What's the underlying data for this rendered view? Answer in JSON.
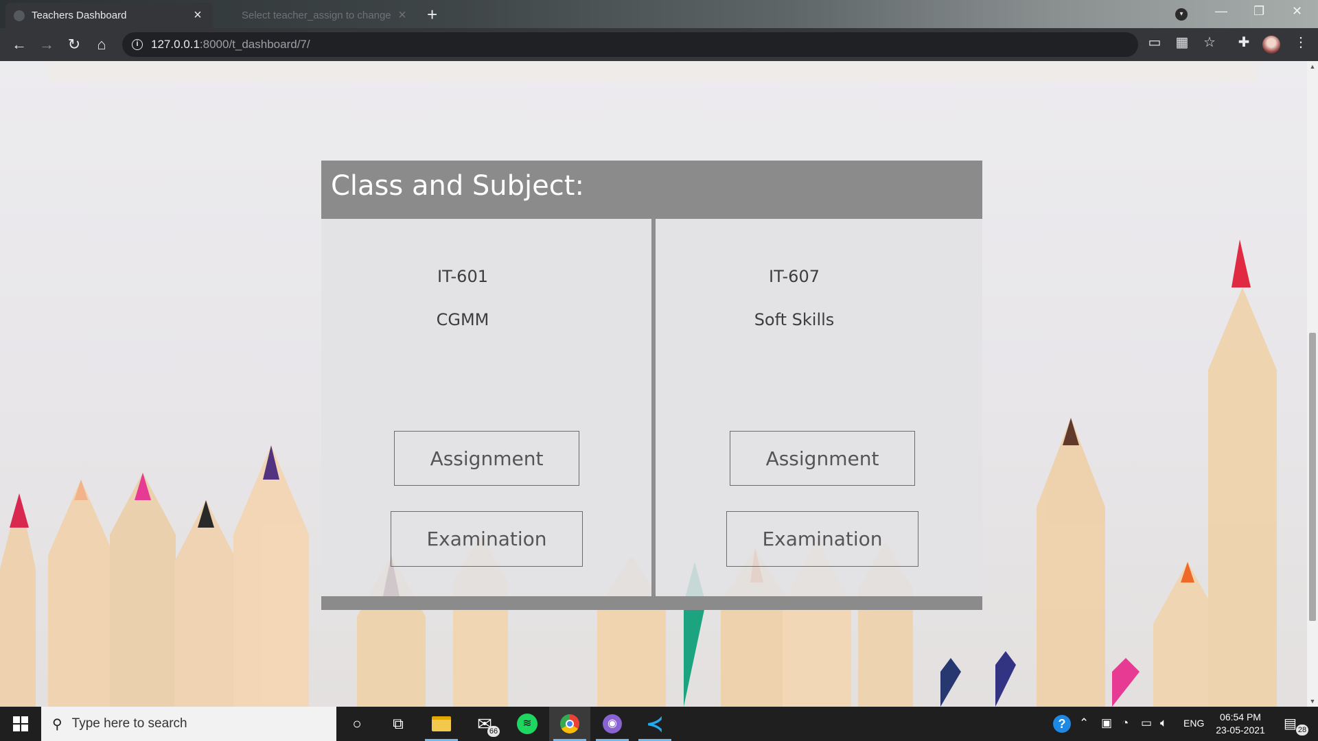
{
  "browser": {
    "tabs": [
      {
        "title": "Teachers Dashboard",
        "active": true
      },
      {
        "title": "Select teacher_assign to change",
        "active": false
      }
    ],
    "url_host": "127.0.0.1",
    "url_path": ":8000/t_dashboard/7/"
  },
  "page": {
    "card_title": "Class and Subject:",
    "classes": [
      {
        "code": "IT-601",
        "subject": "CGMM",
        "assignment_label": "Assignment",
        "examination_label": "Examination"
      },
      {
        "code": "IT-607",
        "subject": "Soft Skills",
        "assignment_label": "Assignment",
        "examination_label": "Examination"
      }
    ]
  },
  "taskbar": {
    "search_placeholder": "Type here to search",
    "mail_badge": "66",
    "language": "ENG",
    "time": "06:54 PM",
    "date": "23-05-2021",
    "notification_count": "28"
  },
  "colors": {
    "card_header": "#8b8b8b",
    "panel_bg": "#e2e2e4",
    "browser_dark": "#35363a",
    "taskbar": "#1f1f1f"
  }
}
